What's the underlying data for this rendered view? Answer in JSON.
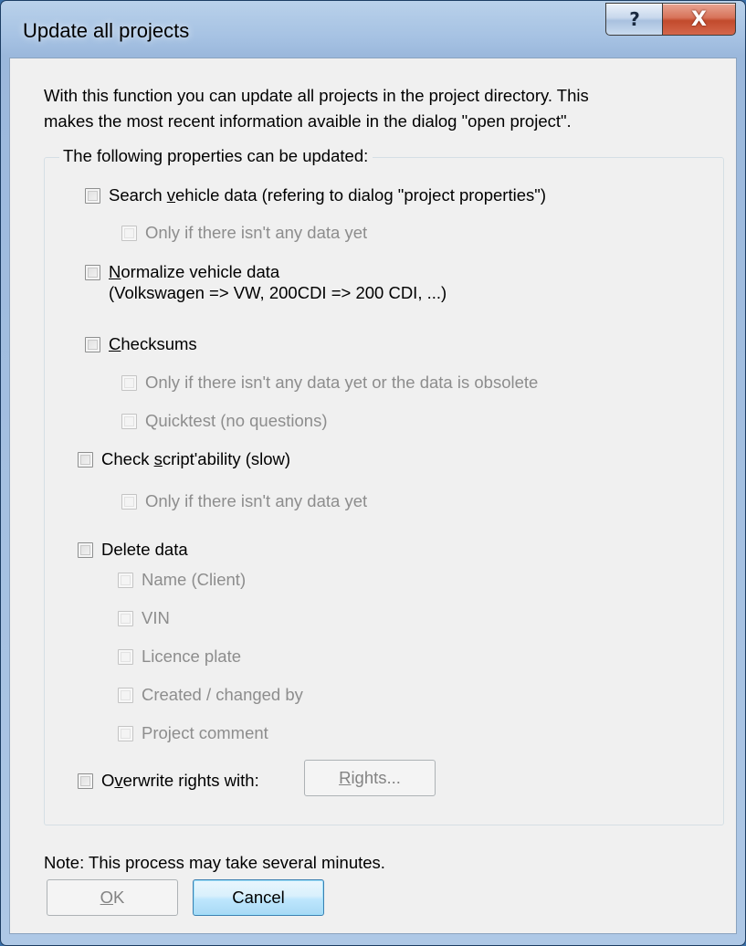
{
  "window": {
    "title": "Update all projects",
    "help_glyph": "?",
    "close_glyph": "X"
  },
  "description": {
    "line1": "With this function you can update all projects in the project directory. This",
    "line2": "makes the most recent information avaible in the dialog \"open project\"."
  },
  "group": {
    "label": "The following properties can be updated:"
  },
  "options": {
    "search": {
      "pre": "Search ",
      "ul": "v",
      "post": "ehicle data (refering to dialog \"project properties\")",
      "checked": false
    },
    "search_only": {
      "label": "Only if there isn't any data yet",
      "checked": false,
      "enabled": false
    },
    "normalize": {
      "ul": "N",
      "post": "ormalize vehicle data",
      "line2": "(Volkswagen => VW, 200CDI => 200 CDI, ...)",
      "checked": false
    },
    "checksums": {
      "ul": "C",
      "post": "hecksums",
      "checked": false
    },
    "checksums_only": {
      "label": "Only if there isn't any data yet or the data is obsolete",
      "checked": false,
      "enabled": false
    },
    "quicktest": {
      "label": "Quicktest (no questions)",
      "checked": false,
      "enabled": false
    },
    "script": {
      "pre": "Check ",
      "ul": "s",
      "post": "cript'ability (slow)",
      "checked": false
    },
    "script_only": {
      "label": "Only if there isn't any data yet",
      "checked": false,
      "enabled": false
    },
    "delete": {
      "label": "Delete data",
      "checked": false
    },
    "delete_items": [
      {
        "label": "Name (Client)",
        "checked": false,
        "enabled": false
      },
      {
        "label": "VIN",
        "checked": false,
        "enabled": false
      },
      {
        "label": "Licence plate",
        "checked": false,
        "enabled": false
      },
      {
        "label": "Created / changed by",
        "checked": false,
        "enabled": false
      },
      {
        "label": "Project comment",
        "checked": false,
        "enabled": false
      }
    ],
    "overwrite": {
      "pre": "O",
      "ul": "v",
      "post": "erwrite rights with:",
      "checked": false
    },
    "rights_button": {
      "ul": "R",
      "post": "ights...",
      "enabled": false
    }
  },
  "note": "Note: This process may take several minutes.",
  "buttons": {
    "ok": {
      "ul": "O",
      "post": "K",
      "enabled": false
    },
    "cancel": "Cancel"
  }
}
